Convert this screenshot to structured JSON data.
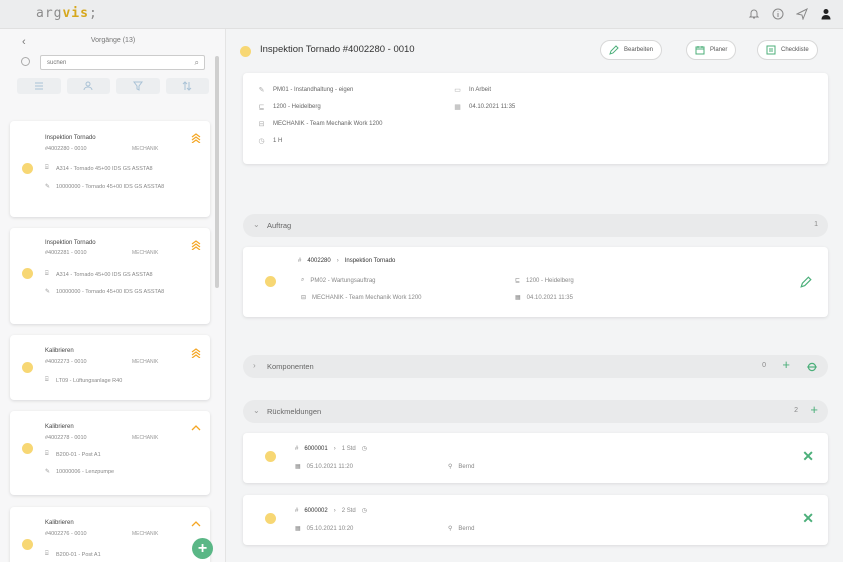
{
  "app": {
    "logo_prefix": "arg",
    "logo_accent": "vis",
    "logo_suffix": ";",
    "accent_color": "#d6a71d"
  },
  "topbar": {
    "icons": [
      "bell-icon",
      "info-icon",
      "send-icon",
      "user-icon"
    ]
  },
  "sidebar": {
    "back": "‹",
    "title": "Vorgänge (13)",
    "search_placeholder": "suchen",
    "tools": [
      "list-icon",
      "person-icon",
      "filter-icon",
      "sort-icon"
    ],
    "cards": [
      {
        "title": "Inspektion Tornado",
        "number": "#4002280 - 0010",
        "workcenter": "MECHANIK",
        "prio": "high",
        "line1": "A314 - Tornado 45+00 IDS GS ASSTA8",
        "line2": "10000000 - Tornado 45+00 IDS GS ASSTA8"
      },
      {
        "title": "Inspektion Tornado",
        "number": "#4002281 - 0010",
        "workcenter": "MECHANIK",
        "prio": "high",
        "line1": "A314 - Tornado 45+00 IDS GS ASSTA8",
        "line2": "10000000 - Tornado 45+00 IDS GS ASSTA8"
      },
      {
        "title": "Kalibrieren",
        "number": "#4002273 - 0010",
        "workcenter": "MECHANIK",
        "prio": "high",
        "line1": "LT09 - Lüftungsanlage R40",
        "line2": ""
      },
      {
        "title": "Kalibrieren",
        "number": "#4002278 - 0010",
        "workcenter": "MECHANIK",
        "prio": "medium",
        "line1": "B200-01 - Post A1",
        "line2": "10000006 - Lenzpumpe"
      },
      {
        "title": "Kalibrieren",
        "number": "#4002276 - 0010",
        "workcenter": "MECHANIK",
        "prio": "medium",
        "line1": "B200-01 - Post A1",
        "line2": ""
      }
    ],
    "fab_label": "+"
  },
  "main": {
    "title": "Inspektion Tornado #4002280 - 0010",
    "buttons": {
      "edit": "Bearbeiten",
      "planer": "Planer",
      "checklist": "Checkliste"
    },
    "info": {
      "type": "PM01 - Instandhaltung - eigen",
      "plant": "1200 - Heidelberg",
      "workcenter": "MECHANIK - Team Mechanik Work 1200",
      "duration": "1 H",
      "status": "In Arbeit",
      "date": "04.10.2021 11:35"
    },
    "sections": {
      "auftrag": {
        "title": "Auftrag",
        "count": "1"
      },
      "komponenten": {
        "title": "Komponenten",
        "count": "0"
      },
      "rueckmeldungen": {
        "title": "Rückmeldungen",
        "count": "2"
      }
    },
    "order": {
      "number": "4002280",
      "name": "Inspektion Tornado",
      "type": "PM02 - Wartungsauftrag",
      "plant": "1200 - Heidelberg",
      "workcenter": "MECHANIK - Team Mechanik Work 1200",
      "date": "04.10.2021 11:35"
    },
    "confirmations": [
      {
        "number": "6000001",
        "qty": "1 Std",
        "date": "05.10.2021 11:20",
        "user": "Bernd"
      },
      {
        "number": "6000002",
        "qty": "2 Std",
        "date": "05.10.2021 10:20",
        "user": "Bernd"
      }
    ]
  }
}
